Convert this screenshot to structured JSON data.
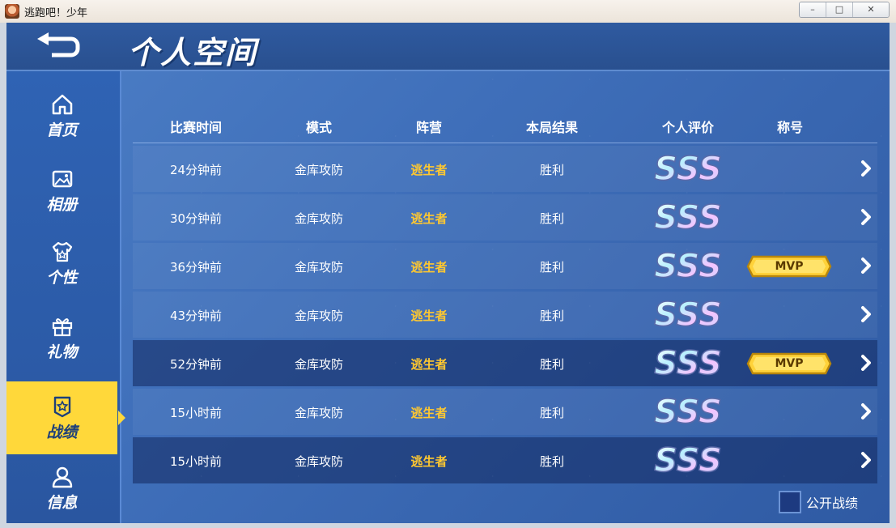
{
  "window": {
    "title": "逃跑吧！少年",
    "minimize": "–",
    "maximize": "□",
    "close": "✕"
  },
  "header": {
    "title": "个人空间"
  },
  "sidebar": {
    "items": [
      {
        "label": "首页",
        "icon": "home-icon",
        "active": false
      },
      {
        "label": "相册",
        "icon": "photo-icon",
        "active": false
      },
      {
        "label": "个性",
        "icon": "shirt-icon",
        "active": false
      },
      {
        "label": "礼物",
        "icon": "gift-icon",
        "active": false
      },
      {
        "label": "战绩",
        "icon": "badge-icon",
        "active": true
      },
      {
        "label": "信息",
        "icon": "user-icon",
        "active": false
      }
    ]
  },
  "table": {
    "headers": [
      "比赛时间",
      "模式",
      "阵营",
      "本局结果",
      "个人评价",
      "称号"
    ],
    "rows": [
      {
        "time": "24分钟前",
        "mode": "金库攻防",
        "camp": "逃生者",
        "result": "胜利",
        "rating": "SSS",
        "title": ""
      },
      {
        "time": "30分钟前",
        "mode": "金库攻防",
        "camp": "逃生者",
        "result": "胜利",
        "rating": "SSS",
        "title": ""
      },
      {
        "time": "36分钟前",
        "mode": "金库攻防",
        "camp": "逃生者",
        "result": "胜利",
        "rating": "SSS",
        "title": "MVP"
      },
      {
        "time": "43分钟前",
        "mode": "金库攻防",
        "camp": "逃生者",
        "result": "胜利",
        "rating": "SSS",
        "title": ""
      },
      {
        "time": "52分钟前",
        "mode": "金库攻防",
        "camp": "逃生者",
        "result": "胜利",
        "rating": "SSS",
        "title": "MVP"
      },
      {
        "time": "15小时前",
        "mode": "金库攻防",
        "camp": "逃生者",
        "result": "胜利",
        "rating": "SSS",
        "title": ""
      },
      {
        "time": "15小时前",
        "mode": "金库攻防",
        "camp": "逃生者",
        "result": "胜利",
        "rating": "SSS",
        "title": ""
      }
    ]
  },
  "footer": {
    "public_label": "公开战绩",
    "public_checked": false
  },
  "colors": {
    "accent": "#ffd83a",
    "camp": "#ffc830",
    "background": "#3f6fba"
  }
}
